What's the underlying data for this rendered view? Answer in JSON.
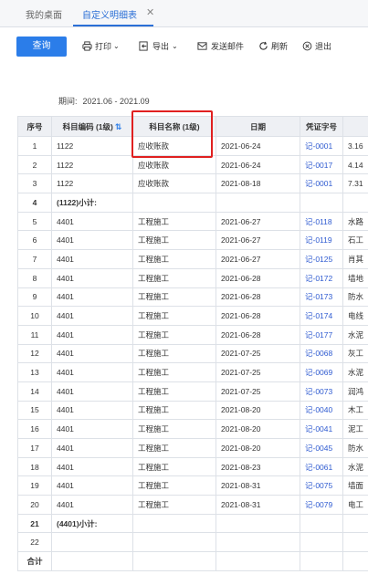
{
  "tabs": [
    {
      "label": "我的桌面"
    },
    {
      "label": "自定义明细表"
    }
  ],
  "toolbar": {
    "query_label": "查询",
    "print_label": "打印",
    "export_label": "导出",
    "email_label": "发送邮件",
    "refresh_label": "刷新",
    "exit_label": "退出"
  },
  "period": {
    "label": "期间:",
    "value": "2021.06 - 2021.09"
  },
  "table": {
    "headers": [
      "序号",
      "科目编码 (1级)",
      "科目名称 (1级)",
      "日期",
      "凭证字号",
      ""
    ],
    "rows": [
      {
        "seq": "1",
        "code": "1122",
        "name": "应收账款",
        "date": "2021-06-24",
        "voucher": "记-0001",
        "summary": "3.16"
      },
      {
        "seq": "2",
        "code": "1122",
        "name": "应收账款",
        "date": "2021-06-24",
        "voucher": "记-0017",
        "summary": "4.14"
      },
      {
        "seq": "3",
        "code": "1122",
        "name": "应收账款",
        "date": "2021-08-18",
        "voucher": "记-0001",
        "summary": "7.31"
      },
      {
        "seq": "4",
        "code": "(1122)小计:",
        "name": "",
        "date": "",
        "voucher": "",
        "summary": "",
        "subtotal": true
      },
      {
        "seq": "5",
        "code": "4401",
        "name": "工程施工",
        "date": "2021-06-27",
        "voucher": "记-0118",
        "summary": "水路"
      },
      {
        "seq": "6",
        "code": "4401",
        "name": "工程施工",
        "date": "2021-06-27",
        "voucher": "记-0119",
        "summary": "石工"
      },
      {
        "seq": "7",
        "code": "4401",
        "name": "工程施工",
        "date": "2021-06-27",
        "voucher": "记-0125",
        "summary": "肖其"
      },
      {
        "seq": "8",
        "code": "4401",
        "name": "工程施工",
        "date": "2021-06-28",
        "voucher": "记-0172",
        "summary": "墙地"
      },
      {
        "seq": "9",
        "code": "4401",
        "name": "工程施工",
        "date": "2021-06-28",
        "voucher": "记-0173",
        "summary": "防水"
      },
      {
        "seq": "10",
        "code": "4401",
        "name": "工程施工",
        "date": "2021-06-28",
        "voucher": "记-0174",
        "summary": "电线"
      },
      {
        "seq": "11",
        "code": "4401",
        "name": "工程施工",
        "date": "2021-06-28",
        "voucher": "记-0177",
        "summary": "水泥"
      },
      {
        "seq": "12",
        "code": "4401",
        "name": "工程施工",
        "date": "2021-07-25",
        "voucher": "记-0068",
        "summary": "灰工"
      },
      {
        "seq": "13",
        "code": "4401",
        "name": "工程施工",
        "date": "2021-07-25",
        "voucher": "记-0069",
        "summary": "水泥"
      },
      {
        "seq": "14",
        "code": "4401",
        "name": "工程施工",
        "date": "2021-07-25",
        "voucher": "记-0073",
        "summary": "润鸿"
      },
      {
        "seq": "15",
        "code": "4401",
        "name": "工程施工",
        "date": "2021-08-20",
        "voucher": "记-0040",
        "summary": "木工"
      },
      {
        "seq": "16",
        "code": "4401",
        "name": "工程施工",
        "date": "2021-08-20",
        "voucher": "记-0041",
        "summary": "泥工"
      },
      {
        "seq": "17",
        "code": "4401",
        "name": "工程施工",
        "date": "2021-08-20",
        "voucher": "记-0045",
        "summary": "防水"
      },
      {
        "seq": "18",
        "code": "4401",
        "name": "工程施工",
        "date": "2021-08-23",
        "voucher": "记-0061",
        "summary": "水泥"
      },
      {
        "seq": "19",
        "code": "4401",
        "name": "工程施工",
        "date": "2021-08-31",
        "voucher": "记-0075",
        "summary": "墙面"
      },
      {
        "seq": "20",
        "code": "4401",
        "name": "工程施工",
        "date": "2021-08-31",
        "voucher": "记-0079",
        "summary": "电工"
      },
      {
        "seq": "21",
        "code": "(4401)小计:",
        "name": "",
        "date": "",
        "voucher": "",
        "summary": "",
        "subtotal": true
      },
      {
        "seq": "22",
        "code": "",
        "name": "",
        "date": "",
        "voucher": "",
        "summary": ""
      },
      {
        "seq": "合计",
        "code": "",
        "name": "",
        "date": "",
        "voucher": "",
        "summary": "",
        "total": true
      }
    ]
  },
  "colors": {
    "accent": "#2b7de9",
    "voucher_link": "#2f5bd1",
    "highlight_box": "#e02020",
    "header_bg": "#eef0f4"
  },
  "icons": {
    "sort": "sort-arrow-icon",
    "print": "printer-icon",
    "export": "export-icon",
    "email": "mail-icon",
    "refresh": "refresh-icon",
    "exit": "close-circle-icon",
    "tab_close": "close-icon"
  }
}
